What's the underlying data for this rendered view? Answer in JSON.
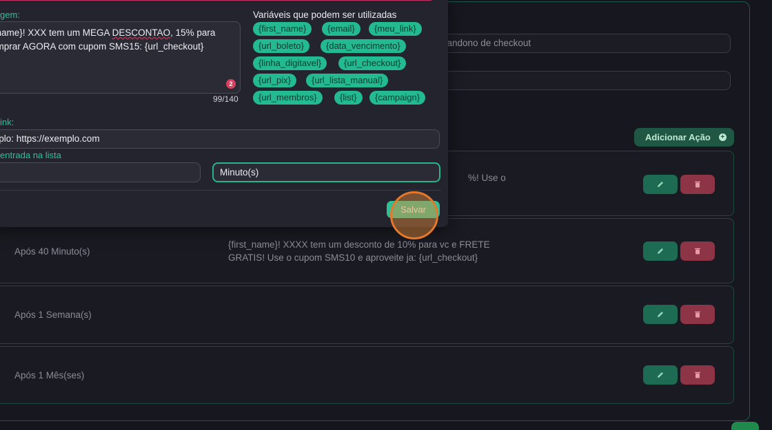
{
  "background": {
    "trigger_field": "bandono de checkout",
    "add_action_label": "Adicionar Ação",
    "row1_message_partial": "%! Use o",
    "rows": [
      {
        "timing": "Após 40 Minuto(s)",
        "message_line1": "{first_name}! XXXX tem um desconto de 10% para vc e FRETE",
        "message_line2": "GRATIS! Use o cupom SMS10 e aproveite ja: {url_checkout}"
      },
      {
        "timing": "Após 1 Semana(s)",
        "message_line1": "",
        "message_line2": ""
      },
      {
        "timing": "Após 1 Mês(ses)",
        "message_line1": "",
        "message_line2": ""
      }
    ]
  },
  "modal": {
    "message_label": "gem:",
    "message_line1_a": "_name}! XXX tem um MEGA ",
    "message_misspelled": "DESCONTAO",
    "message_line1_b": ", 15% para",
    "message_line2": "omprar AGORA com cupom SMS15: {url_checkout}",
    "warning_count": "2",
    "char_counter": "99/140",
    "variables_title": "Variáveis que podem ser utilizadas",
    "variables": [
      "{first_name}",
      "{email}",
      "{meu_link}",
      "{url_boleto}",
      "{data_vencimento}",
      "{linha_digitavel}",
      "{url_checkout}",
      "{url_pix}",
      "{url_lista_manual}",
      "{url_membros}",
      "{list}",
      "{campaign}"
    ],
    "link_label": "ink:",
    "link_value": "mplo: https://exemplo.com",
    "delay_label": "entrada na lista",
    "unit_value": "Minuto(s)",
    "save_label": "Salvar"
  },
  "colors": {
    "accent": "#29c49a",
    "danger": "#8e3447",
    "edit": "#1d6b53"
  }
}
